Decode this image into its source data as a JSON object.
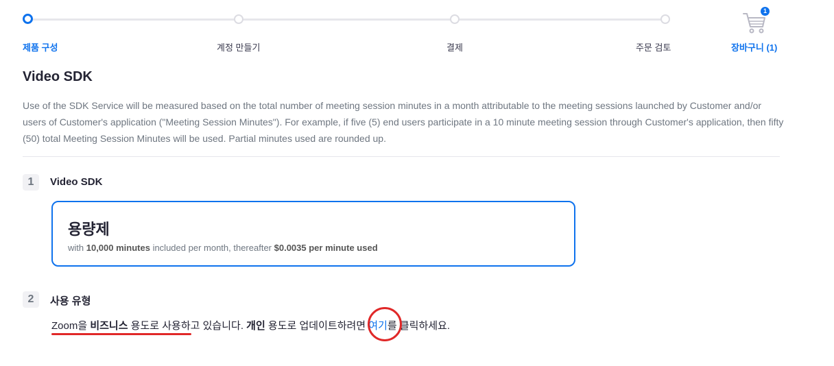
{
  "stepper": {
    "steps": [
      {
        "label": "제품 구성",
        "active": true
      },
      {
        "label": "계정 만들기",
        "active": false
      },
      {
        "label": "결제",
        "active": false
      },
      {
        "label": "주문 검토",
        "active": false
      }
    ],
    "cart": {
      "label": "장바구니 (1)",
      "count": "1",
      "icon": "cart-icon"
    }
  },
  "header": {
    "title": "Video SDK",
    "description": "Use of the SDK Service will be measured based on the total number of meeting session minutes in a month attributable to the meeting sessions launched by Customer and/or users of Customer's application (\"Meeting Session Minutes\"). For example, if five (5) end users participate in a 10 minute meeting session through Customer's application, then fifty (50) total Meeting Session Minutes will be used. Partial minutes used are rounded up."
  },
  "section1": {
    "number": "1",
    "title": "Video SDK",
    "plan": {
      "name": "용량제",
      "desc_prefix": "with ",
      "desc_minutes": "10,000 minutes",
      "desc_middle": " included per month, thereafter ",
      "desc_price": "$0.0035 per minute used"
    }
  },
  "section2": {
    "number": "2",
    "title": "사용 유형",
    "text_part1": "Zoom을 ",
    "text_bold1": "비즈니스",
    "text_part2": " 용도로 사용하고 있습니다. ",
    "text_bold2": "개인",
    "text_part3": " 용도로 업데이트하려면 ",
    "link": "여기",
    "text_part4": "를 클릭하세요."
  },
  "colors": {
    "accent": "#0e72ed",
    "annotation": "#e02828"
  }
}
